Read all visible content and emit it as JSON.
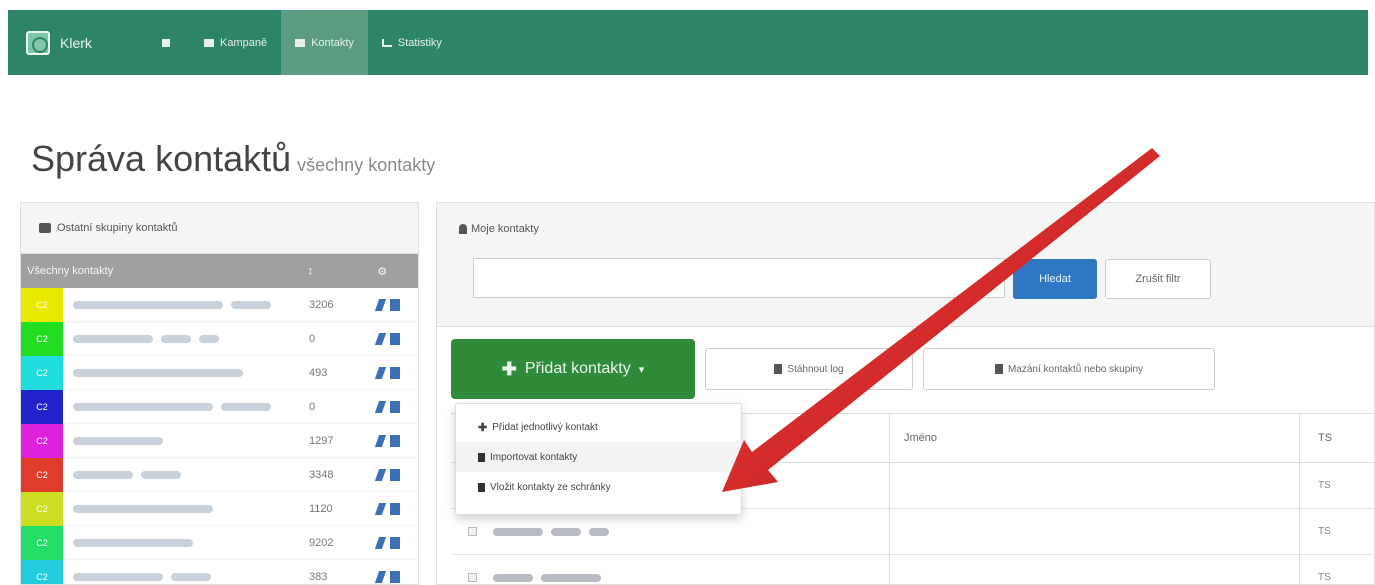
{
  "navbar": {
    "brand": "Klerk",
    "items": [
      {
        "label": "",
        "icon": "home-icon"
      },
      {
        "label": "Kampaně",
        "icon": "envelope-icon"
      },
      {
        "label": "Kontakty",
        "icon": "contacts-icon",
        "active": true
      },
      {
        "label": "Statistiky",
        "icon": "chart-icon"
      }
    ]
  },
  "page": {
    "title": "Správa kontaktů",
    "subtitle": "všechny kontakty"
  },
  "groups_panel": {
    "heading": "Ostatní skupiny kontaktů",
    "header_name": "Všechny kontakty",
    "rows": [
      {
        "code": "C2",
        "color": "#e8e800",
        "count": "3206"
      },
      {
        "code": "C2",
        "color": "#22dd22",
        "count": "0"
      },
      {
        "code": "C2",
        "color": "#22dddd",
        "count": "493"
      },
      {
        "code": "C2",
        "color": "#2222cc",
        "count": "0"
      },
      {
        "code": "C2",
        "color": "#dd22dd",
        "count": "1297"
      },
      {
        "code": "C2",
        "color": "#e03c2c",
        "count": "3348"
      },
      {
        "code": "C2",
        "color": "#ccdd22",
        "count": "1120"
      },
      {
        "code": "C2",
        "color": "#22dd66",
        "count": "9202"
      },
      {
        "code": "C2",
        "color": "#22ccdd",
        "count": "383"
      }
    ]
  },
  "contacts_panel": {
    "heading": "Moje kontakty",
    "search_placeholder": "",
    "search_button": "Hledat",
    "cancel_button": "Zrušit filtr",
    "add_button": "Přidat kontakty",
    "download_button": "Stáhnout log",
    "delete_button": "Mazání kontaktů nebo skupiny",
    "table": {
      "col_name": "Jméno",
      "col_ts": "TS",
      "rows": [
        {
          "ts": "TS"
        },
        {
          "ts": "TS"
        },
        {
          "ts": "TS"
        }
      ]
    }
  },
  "add_menu": {
    "items": [
      {
        "label": "Přidat jednotlivý kontakt",
        "icon": "plus-icon"
      },
      {
        "label": "Importovat kontakty",
        "icon": "file-icon"
      },
      {
        "label": "Vložit kontakty ze schránky",
        "icon": "clipboard-icon"
      }
    ]
  },
  "colors": {
    "navbar": "#2e8466",
    "add_button": "#2f8a3a",
    "search_button": "#2f77c3",
    "arrow": "#d81818"
  }
}
